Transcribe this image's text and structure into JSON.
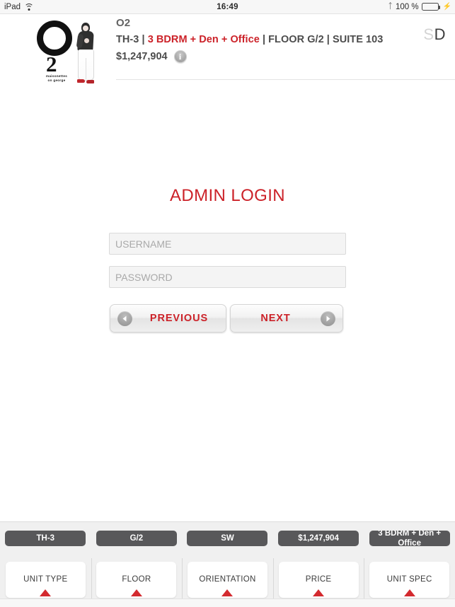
{
  "statusbar": {
    "device": "iPad",
    "wifi_icon": "wifi-icon",
    "time": "16:49",
    "bluetooth_icon": "bluetooth-icon",
    "battery_percent": "100 %",
    "battery_icon": "battery-full-icon",
    "charging_icon": "charging-bolt-icon"
  },
  "header": {
    "logo": {
      "mark": "O",
      "number": "2",
      "tagline_line1": "maisonettes",
      "tagline_line2": "on george",
      "figure_icon": "person-illustration-icon"
    },
    "project_title": "O2",
    "unit_line": {
      "unit": "TH-3",
      "sep1": " | ",
      "spec": "3 BDRM + Den + Office",
      "sep2": " | ",
      "floor": "FLOOR G/2",
      "sep3": " | ",
      "suite": "SUITE 103"
    },
    "price": "$1,247,904",
    "info_icon": "info-icon",
    "brand_mark": {
      "light": "S",
      "dark": "D"
    }
  },
  "login": {
    "title": "ADMIN LOGIN",
    "username": {
      "value": "",
      "placeholder": "USERNAME"
    },
    "password": {
      "value": "",
      "placeholder": "PASSWORD"
    },
    "previous_label": "PREVIOUS",
    "next_label": "NEXT",
    "previous_icon": "arrow-left-circle-icon",
    "next_icon": "arrow-right-circle-icon"
  },
  "filters": [
    {
      "pill": "TH-3",
      "label": "UNIT TYPE"
    },
    {
      "pill": "G/2",
      "label": "FLOOR"
    },
    {
      "pill": "SW",
      "label": "ORIENTATION"
    },
    {
      "pill": "$1,247,904",
      "label": "PRICE"
    },
    {
      "pill": "3 BDRM + Den + Office",
      "label": "UNIT SPEC"
    }
  ],
  "colors": {
    "accent_red": "#cc2229",
    "pill_gray": "#58585a",
    "triangle_red": "#d32a2f",
    "battery_green": "#4cd964"
  }
}
